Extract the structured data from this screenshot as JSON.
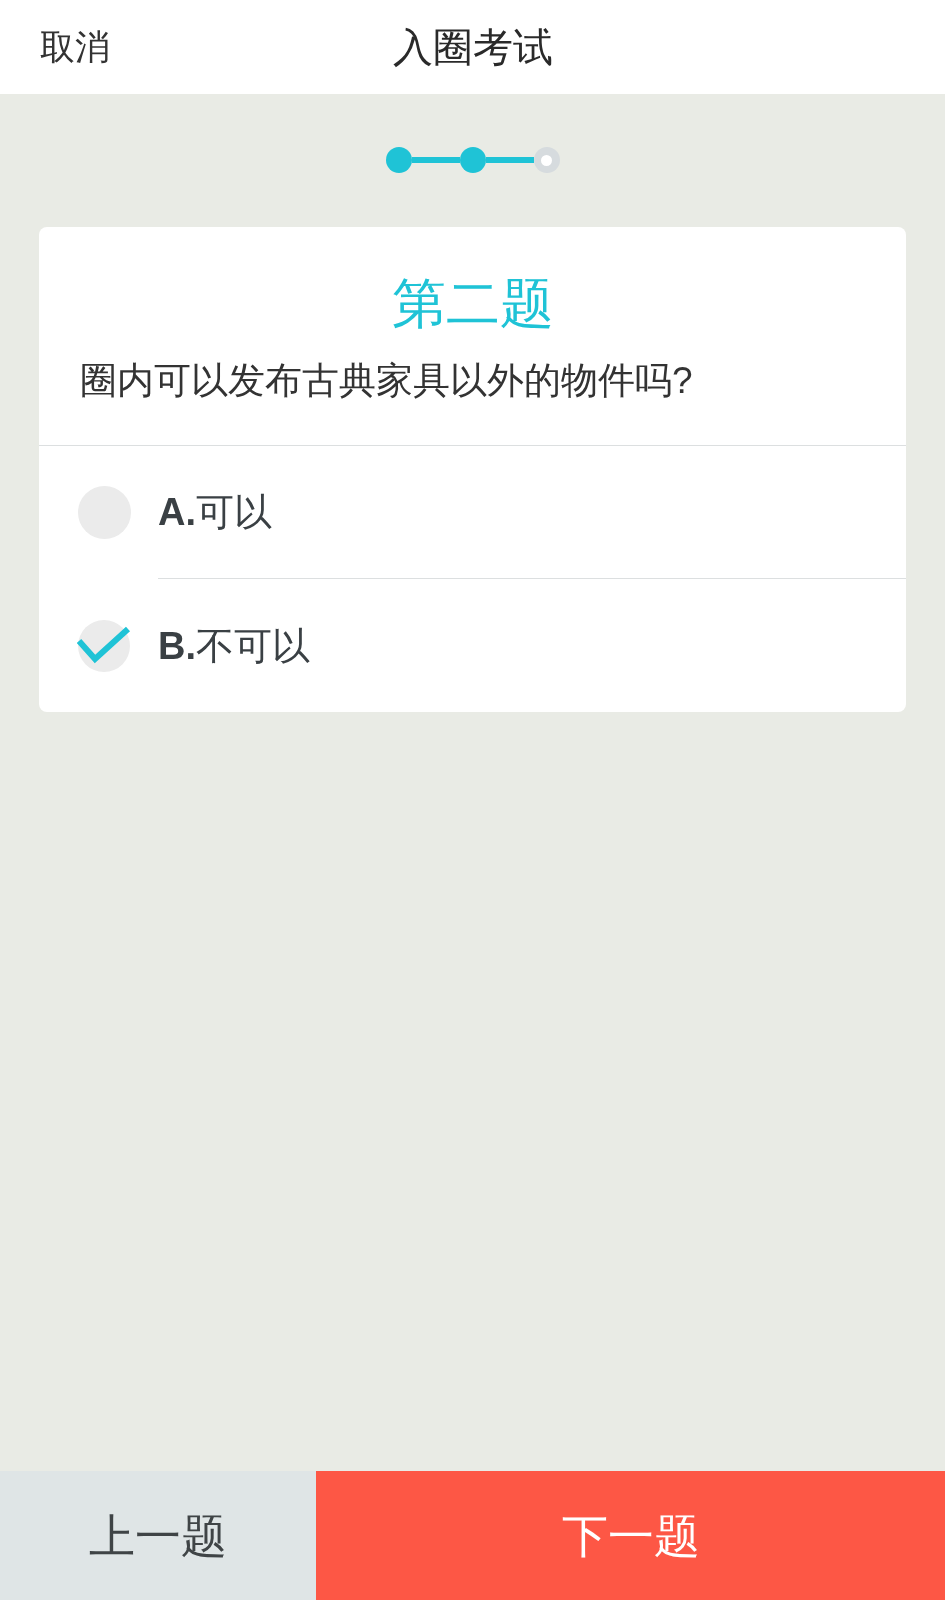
{
  "header": {
    "cancel": "取消",
    "title": "入圈考试"
  },
  "progress": {
    "steps": [
      {
        "completed": true
      },
      {
        "completed": true
      },
      {
        "completed": false
      }
    ]
  },
  "question": {
    "heading": "第二题",
    "text": "圈内可以发布古典家具以外的物件吗?",
    "options": [
      {
        "label": "**A.**可以",
        "selected": false
      },
      {
        "label": "**B.**不可以",
        "selected": true
      }
    ]
  },
  "footer": {
    "buttons": [
      {
        "label": "上一题",
        "kind": "secondary"
      },
      {
        "label": "下一题",
        "kind": "primary"
      }
    ]
  }
}
